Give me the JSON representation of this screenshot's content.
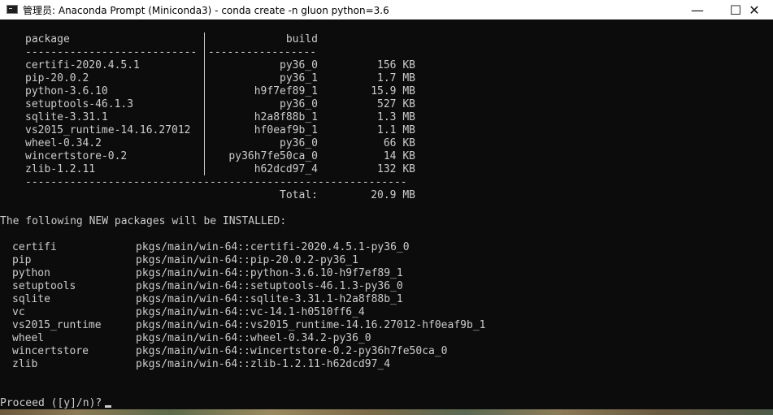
{
  "window": {
    "title": "管理员: Anaconda Prompt (Miniconda3) - conda  create -n gluon python=3.6",
    "icon": "terminal-icon",
    "minimize": "—",
    "maximize": "☐",
    "close": "✕"
  },
  "table": {
    "header_package": "package",
    "header_build": "build",
    "sep_left": "---------------------------",
    "sep_right": "-----------------",
    "rows": [
      {
        "package": "certifi-2020.4.5.1",
        "build": "py36_0",
        "size": "156 KB"
      },
      {
        "package": "pip-20.0.2",
        "build": "py36_1",
        "size": "1.7 MB"
      },
      {
        "package": "python-3.6.10",
        "build": "h9f7ef89_1",
        "size": "15.9 MB"
      },
      {
        "package": "setuptools-46.1.3",
        "build": "py36_0",
        "size": "527 KB"
      },
      {
        "package": "sqlite-3.31.1",
        "build": "h2a8f88b_1",
        "size": "1.3 MB"
      },
      {
        "package": "vs2015_runtime-14.16.27012",
        "build": "hf0eaf9b_1",
        "size": "1.1 MB"
      },
      {
        "package": "wheel-0.34.2",
        "build": "py36_0",
        "size": "66 KB"
      },
      {
        "package": "wincertstore-0.2",
        "build": "py36h7fe50ca_0",
        "size": "14 KB"
      },
      {
        "package": "zlib-1.2.11",
        "build": "h62dcd97_4",
        "size": "132 KB"
      }
    ],
    "bottom_sep": "------------------------------------------------------------",
    "total_label": "Total:",
    "total_value": "20.9 MB"
  },
  "install_header": "The following NEW packages will be INSTALLED:",
  "install_rows": [
    {
      "name": "certifi",
      "spec": "pkgs/main/win-64::certifi-2020.4.5.1-py36_0"
    },
    {
      "name": "pip",
      "spec": "pkgs/main/win-64::pip-20.0.2-py36_1"
    },
    {
      "name": "python",
      "spec": "pkgs/main/win-64::python-3.6.10-h9f7ef89_1"
    },
    {
      "name": "setuptools",
      "spec": "pkgs/main/win-64::setuptools-46.1.3-py36_0"
    },
    {
      "name": "sqlite",
      "spec": "pkgs/main/win-64::sqlite-3.31.1-h2a8f88b_1"
    },
    {
      "name": "vc",
      "spec": "pkgs/main/win-64::vc-14.1-h0510ff6_4"
    },
    {
      "name": "vs2015_runtime",
      "spec": "pkgs/main/win-64::vs2015_runtime-14.16.27012-hf0eaf9b_1"
    },
    {
      "name": "wheel",
      "spec": "pkgs/main/win-64::wheel-0.34.2-py36_0"
    },
    {
      "name": "wincertstore",
      "spec": "pkgs/main/win-64::wincertstore-0.2-py36h7fe50ca_0"
    },
    {
      "name": "zlib",
      "spec": "pkgs/main/win-64::zlib-1.2.11-h62dcd97_4"
    }
  ],
  "prompt": "Proceed ([y]/n)?"
}
